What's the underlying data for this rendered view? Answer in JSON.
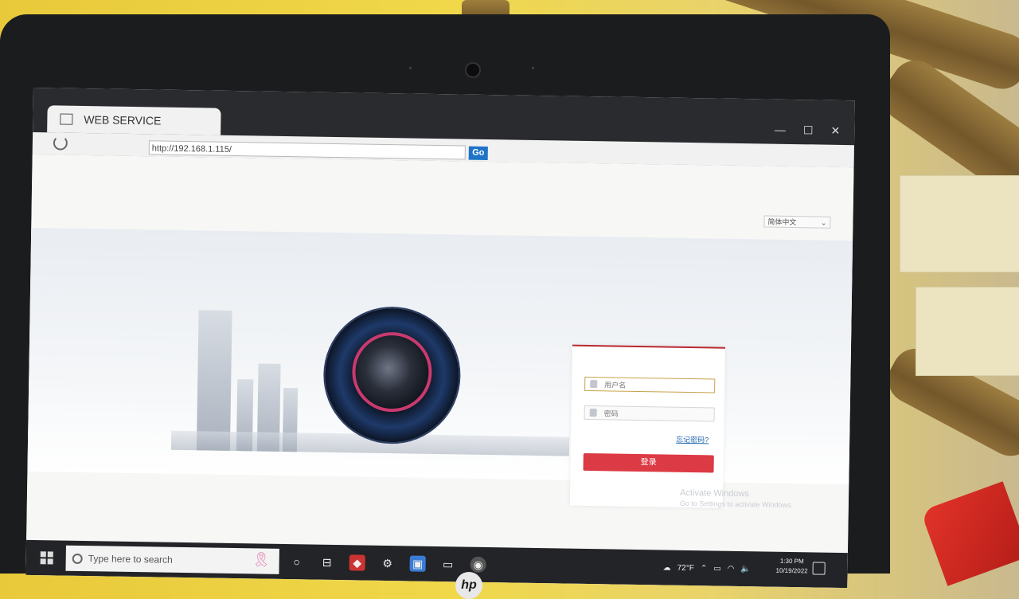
{
  "browser": {
    "tab_title": "WEB SERVICE",
    "address": "http://192.168.1.115/",
    "go_label": "Go",
    "window_buttons": [
      "—",
      "☐",
      "✕"
    ]
  },
  "page": {
    "language": "简体中文",
    "username_placeholder": "用户名",
    "password_placeholder": "密码",
    "forgot_password": "忘记密码?",
    "login_button": "登录",
    "watermark_title": "Activate Windows",
    "watermark_sub": "Go to Settings to activate Windows."
  },
  "taskbar": {
    "search_placeholder": "Type here to search",
    "weather": "72°F",
    "time": "1:30 PM",
    "date": "10/19/2022"
  },
  "device": {
    "brand": "hp"
  }
}
